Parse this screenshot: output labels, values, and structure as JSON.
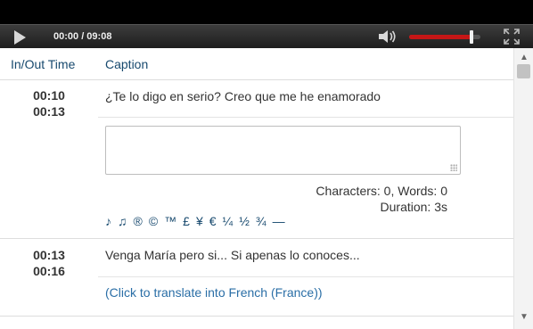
{
  "player": {
    "time": "00:00 / 09:08",
    "volume_level": 0.88,
    "accent_color": "#c51616",
    "icons": [
      "play-icon",
      "volume-icon",
      "fullscreen-icon"
    ]
  },
  "header": {
    "in_out_label": "In/Out Time",
    "caption_label": "Caption"
  },
  "rows": [
    {
      "in_time": "00:10",
      "out_time": "00:13",
      "caption": "¿Te lo digo en serio? Creo que me he enamorado",
      "editor_value": "",
      "stats_chars_words": "Characters: 0, Words: 0",
      "stats_duration": "Duration: 3s",
      "special_chars": [
        "♪",
        "♫",
        "®",
        "©",
        "™",
        "£",
        "¥",
        "€",
        "¼",
        "½",
        "¾",
        "—"
      ]
    },
    {
      "in_time": "00:13",
      "out_time": "00:16",
      "caption": "Venga María pero si... Si apenas lo conoces...",
      "translate_link": "(Click to translate into French (France))"
    }
  ],
  "colors": {
    "header_text": "#17496e",
    "link": "#2a6ea6"
  }
}
